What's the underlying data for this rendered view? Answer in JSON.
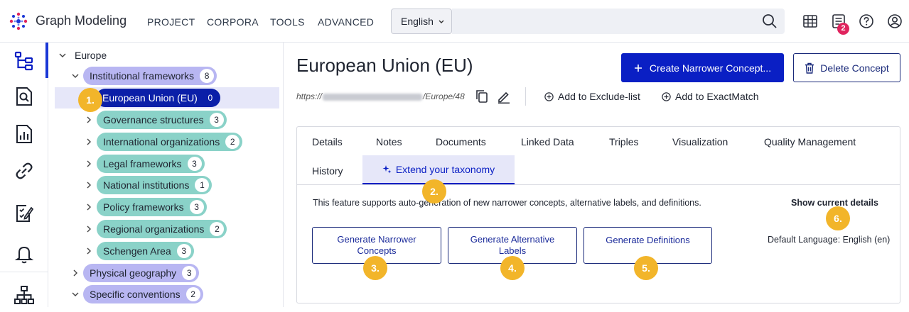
{
  "app": {
    "title": "Graph Modeling"
  },
  "nav": {
    "items": [
      "PROJECT",
      "CORPORA",
      "TOOLS",
      "ADVANCED"
    ]
  },
  "language_select": {
    "value": "English"
  },
  "notifications": {
    "count": "2"
  },
  "tree": {
    "root": "Europe",
    "nodes": [
      {
        "label": "Institutional frameworks",
        "count": "8"
      },
      {
        "label": "European Union (EU)",
        "count": "0"
      },
      {
        "label": "Governance structures",
        "count": "3"
      },
      {
        "label": "International organizations",
        "count": "2"
      },
      {
        "label": "Legal frameworks",
        "count": "3"
      },
      {
        "label": "National institutions",
        "count": "1"
      },
      {
        "label": "Policy frameworks",
        "count": "3"
      },
      {
        "label": "Regional organizations",
        "count": "2"
      },
      {
        "label": "Schengen Area",
        "count": "3"
      },
      {
        "label": "Physical geography",
        "count": "3"
      },
      {
        "label": "Specific conventions",
        "count": "2"
      }
    ]
  },
  "concept": {
    "title": "European Union (EU)",
    "uri_prefix": "https://",
    "uri_suffix": "/Europe/48",
    "create_button": "Create Narrower Concept...",
    "delete_button": "Delete Concept",
    "add_exclude": "Add to Exclude-list",
    "add_exactmatch": "Add to ExactMatch"
  },
  "tabs": [
    "Details",
    "Notes",
    "Documents",
    "Linked Data",
    "Triples",
    "Visualization",
    "Quality Management",
    "History",
    "Extend your taxonomy"
  ],
  "extend": {
    "description": "This feature supports auto-generation of new narrower concepts, alternative labels, and definitions.",
    "show_current": "Show current details",
    "gen_narrower": "Generate Narrower Concepts",
    "gen_altlabels": "Generate Alternative Labels",
    "gen_definitions": "Generate Definitions",
    "default_language": "Default Language: English (en)"
  },
  "markers": [
    "1.",
    "2.",
    "3.",
    "4.",
    "5.",
    "6."
  ],
  "colors": {
    "primary": "#0a1fc4",
    "marker": "#f2b52a",
    "purple_pill": "#b8b6f2",
    "teal_pill": "#8ad2c8",
    "badge": "#e0245e"
  }
}
